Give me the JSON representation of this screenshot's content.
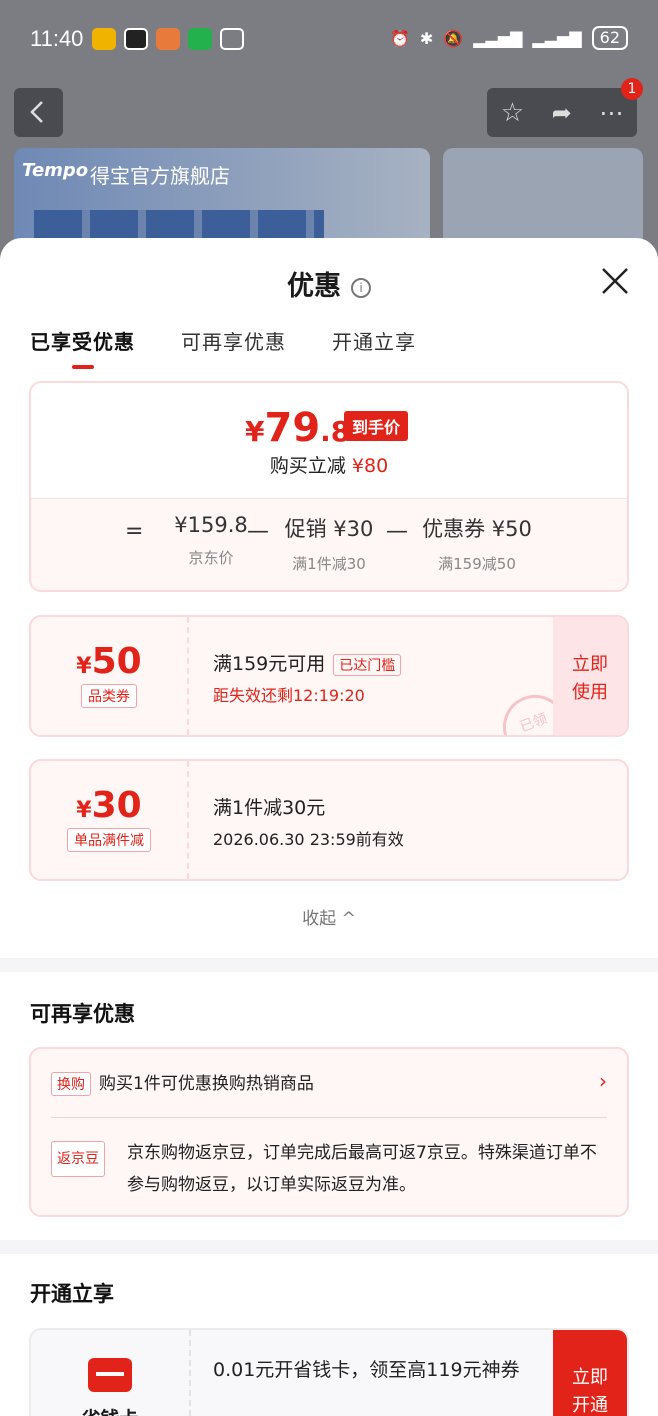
{
  "status_bar": {
    "time": "11:40",
    "battery": "62"
  },
  "background": {
    "badge_count": "1",
    "banner_logo": "Tempo",
    "banner_store": "得宝官方旗舰店"
  },
  "sheet": {
    "title": "优惠",
    "tabs": [
      "已享受优惠",
      "可再享优惠",
      "开通立享"
    ],
    "price": {
      "currency": "¥",
      "final_int": "79",
      "final_dec": ".8",
      "final_tag": "到手价",
      "reduce_label": "购买立减",
      "reduce_amount": "¥80",
      "equals": "=",
      "minus": "—",
      "cols": [
        {
          "value": "¥159.8",
          "sub": "京东价"
        },
        {
          "value": "促销 ¥30",
          "sub": "满1件减30"
        },
        {
          "value": "优惠券 ¥50",
          "sub": "满159减50"
        }
      ]
    },
    "coupons": [
      {
        "amount": "50",
        "type": "品类券",
        "title": "满159元可用",
        "tag": "已达门槛",
        "sub": "距失效还剩12:19:20",
        "button": "立即使用",
        "stamp": "已领"
      },
      {
        "amount": "30",
        "type": "单品满件减",
        "title": "满1件减30元",
        "sub": "2026.06.30 23:59前有效"
      }
    ],
    "collapse": "收起 ^",
    "more_section": {
      "title": "可再享优惠",
      "items": [
        {
          "tag": "换购",
          "text": "购买1件可优惠换购热销商品"
        },
        {
          "tag": "返京豆",
          "text": "京东购物返京豆，订单完成后最高可返7京豆。特殊渠道订单不参与购物返豆，以订单实际返豆为准。"
        }
      ]
    },
    "open_section": {
      "title": "开通立享",
      "card_name": "省钱卡",
      "card_text": "0.01元开省钱卡，领至高119元神券",
      "button": "立即开通"
    }
  },
  "colors": {
    "accent": "#e2231a",
    "pink_bg": "#fff6f6",
    "pink_border": "#fbd9dc"
  }
}
